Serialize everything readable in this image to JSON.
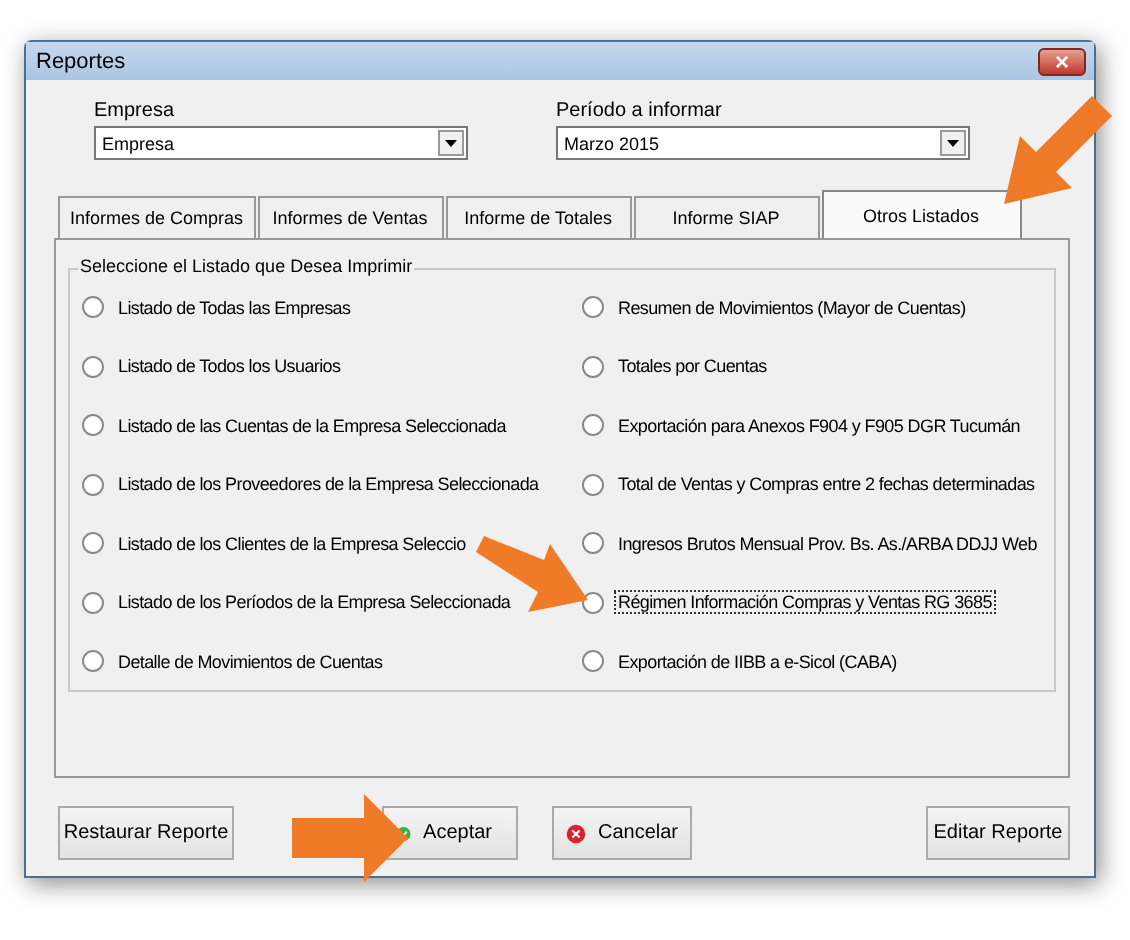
{
  "window": {
    "title": "Reportes",
    "close": "×"
  },
  "fields": [
    {
      "label": "Empresa",
      "value": "Empresa"
    },
    {
      "label": "Período a informar",
      "value": "Marzo 2015"
    }
  ],
  "tabs": [
    {
      "label": "Informes de Compras",
      "selected": false
    },
    {
      "label": "Informes de Ventas",
      "selected": false
    },
    {
      "label": "Informe de Totales",
      "selected": false
    },
    {
      "label": "Informe SIAP",
      "selected": false
    },
    {
      "label": "Otros Listados",
      "selected": true
    }
  ],
  "group": {
    "title": "Seleccione el Listado que Desea Imprimir",
    "columns": [
      [
        {
          "label": "Listado de Todas las Empresas",
          "selected": false,
          "focused": false
        },
        {
          "label": "Listado de Todos los Usuarios",
          "selected": false,
          "focused": false
        },
        {
          "label": "Listado de las Cuentas de la Empresa Seleccionada",
          "selected": false,
          "focused": false
        },
        {
          "label": "Listado de los Proveedores de la Empresa Seleccionada",
          "selected": false,
          "focused": false
        },
        {
          "label": "Listado de los Clientes de la Empresa Seleccio",
          "selected": false,
          "focused": false
        },
        {
          "label": "Listado de los Períodos de la Empresa Seleccionada",
          "selected": false,
          "focused": false
        },
        {
          "label": "Detalle de Movimientos de Cuentas",
          "selected": false,
          "focused": false
        }
      ],
      [
        {
          "label": "Resumen de Movimientos (Mayor de Cuentas)",
          "selected": false,
          "focused": false
        },
        {
          "label": "Totales por Cuentas",
          "selected": false,
          "focused": false
        },
        {
          "label": "Exportación para Anexos F904 y F905 DGR Tucumán",
          "selected": false,
          "focused": false
        },
        {
          "label": "Total de Ventas y Compras entre 2 fechas determinadas",
          "selected": false,
          "focused": false
        },
        {
          "label": "Ingresos Brutos Mensual Prov. Bs. As./ARBA DDJJ Web",
          "selected": false,
          "focused": false
        },
        {
          "label": "Régimen Información Compras y Ventas RG 3685",
          "selected": false,
          "focused": true
        },
        {
          "label": "Exportación de IIBB a e-Sicol (CABA)",
          "selected": false,
          "focused": false
        }
      ]
    ]
  },
  "buttons": [
    {
      "label": "Restaurar Reporte",
      "kind": "plain"
    },
    {
      "label": "Aceptar",
      "kind": "confirm"
    },
    {
      "label": "Cancelar",
      "kind": "cancel"
    },
    {
      "label": "Editar Reporte",
      "kind": "plain"
    }
  ]
}
